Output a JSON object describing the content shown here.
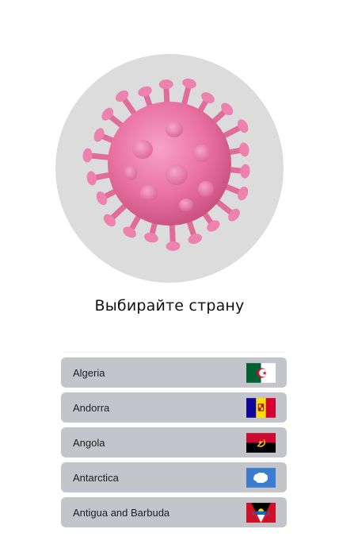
{
  "title": "Выбирайте страну",
  "colors": {
    "hero_background": "#dcdcdc",
    "row_background": "#c4c5ca",
    "virus": "#ea79a8"
  },
  "hero": {
    "icon": "virus-icon"
  },
  "countries": [
    {
      "name": "Algeria",
      "flag": "algeria-flag-icon"
    },
    {
      "name": "Andorra",
      "flag": "andorra-flag-icon"
    },
    {
      "name": "Angola",
      "flag": "angola-flag-icon"
    },
    {
      "name": "Antarctica",
      "flag": "antarctica-flag-icon"
    },
    {
      "name": "Antigua and Barbuda",
      "flag": "antigua-barbuda-flag-icon"
    }
  ]
}
